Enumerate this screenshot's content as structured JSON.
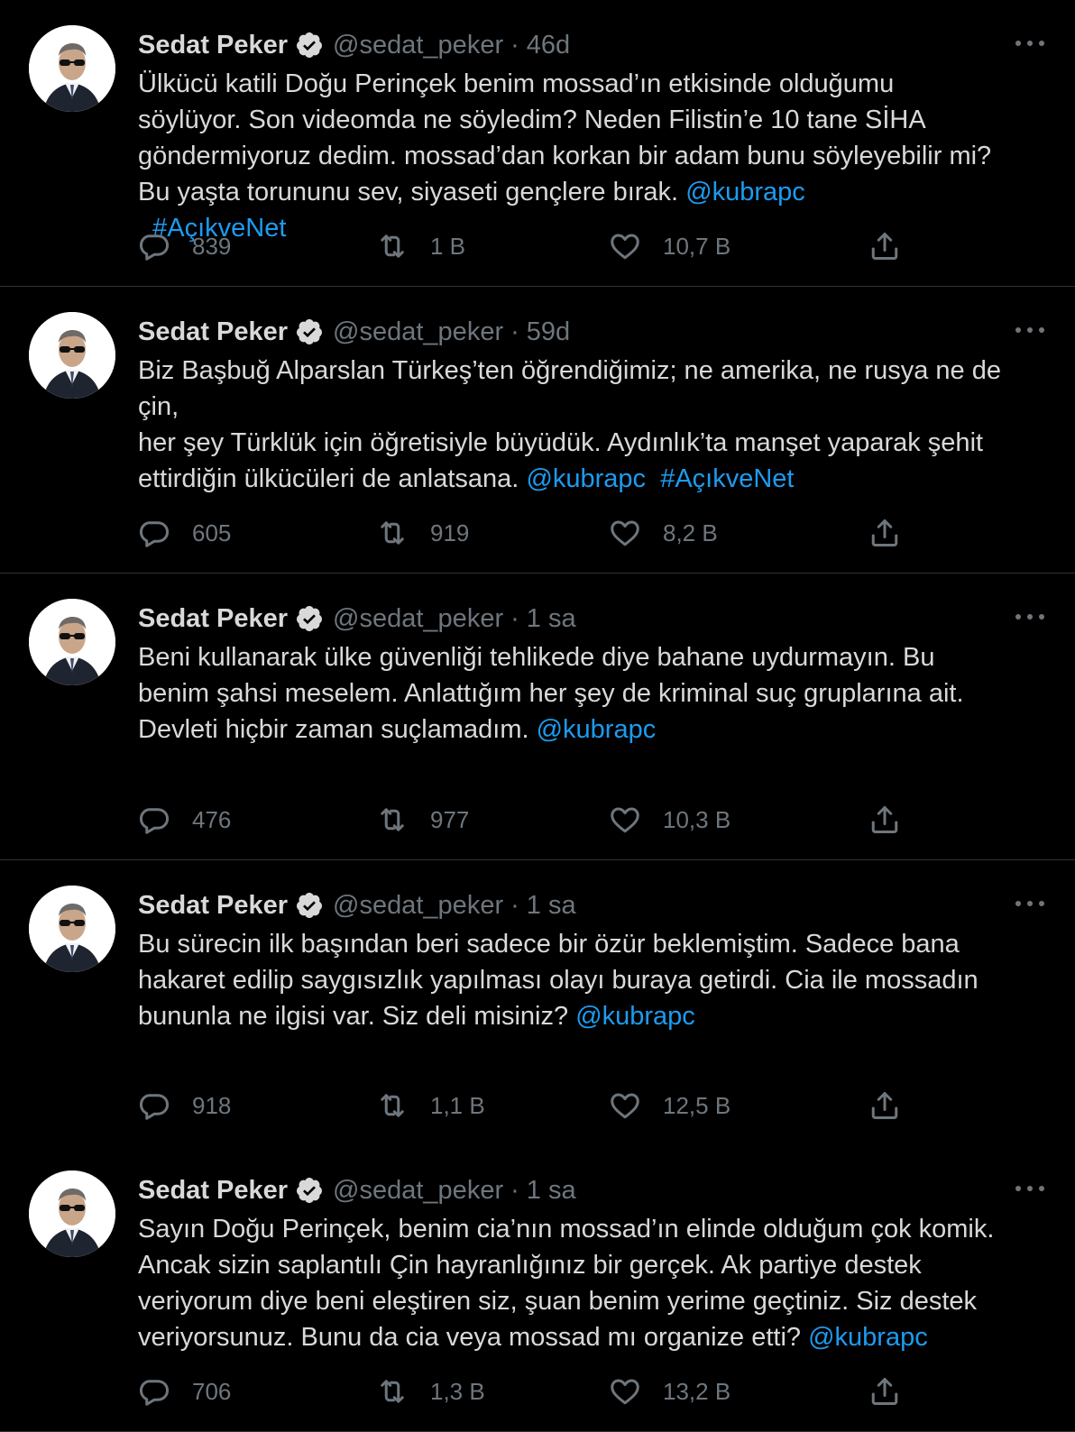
{
  "colors": {
    "background": "#000000",
    "text": "#d9d9d9",
    "muted": "#6e767d",
    "link": "#1d9bf0",
    "divider": "#2f3336"
  },
  "icons": {
    "reply": "speech-bubble-icon",
    "retweet": "retweet-arrows-icon",
    "like": "heart-icon",
    "share": "share-upload-icon",
    "verified": "verified-badge-icon",
    "more": "ellipsis-icon"
  },
  "tweets": [
    {
      "name": "Sedat Peker",
      "handle": "@sedat_peker",
      "sep": "·",
      "time": "46d",
      "lines": [
        [
          {
            "t": "Ülkücü katili Doğu Perinçek benim mossad’ın etkisinde olduğumu"
          }
        ],
        [
          {
            "t": "söylüyor. Son videomda ne söyledim? Neden Filistin’e 10 tane SİHA"
          }
        ],
        [
          {
            "t": "göndermiyoruz dedim. mossad’dan korkan bir adam bunu söyleyebilir mi?"
          }
        ],
        [
          {
            "t": "Bu yaşta torununu sev, siyaseti gençlere bırak. "
          },
          {
            "t": "@kubrapc",
            "link": true
          }
        ],
        [
          {
            "t": "  "
          },
          {
            "t": "#AçıkveNet",
            "link": true
          }
        ]
      ],
      "replies": "839",
      "retweets": "1 B",
      "likes": "10,7 B"
    },
    {
      "name": "Sedat Peker",
      "handle": "@sedat_peker",
      "sep": "·",
      "time": "59d",
      "lines": [
        [
          {
            "t": "Biz Başbuğ Alparslan Türkeş’ten öğrendiğimiz; ne amerika, ne rusya ne de"
          }
        ],
        [
          {
            "t": "çin,"
          }
        ],
        [
          {
            "t": "her şey Türklük için öğretisiyle büyüdük. Aydınlık’ta manşet yaparak şehit"
          }
        ],
        [
          {
            "t": "ettirdiğin ülkücüleri de anlatsana. "
          },
          {
            "t": "@kubrapc",
            "link": true
          },
          {
            "t": "  "
          },
          {
            "t": "#AçıkveNet",
            "link": true
          }
        ]
      ],
      "replies": "605",
      "retweets": "919",
      "likes": "8,2 B"
    },
    {
      "name": "Sedat Peker",
      "handle": "@sedat_peker",
      "sep": "·",
      "time": "1 sa",
      "lines": [
        [
          {
            "t": "Beni kullanarak ülke güvenliği tehlikede diye bahane uydurmayın. Bu"
          }
        ],
        [
          {
            "t": "benim şahsi meselem. Anlattığım her şey de kriminal suç gruplarına ait."
          }
        ],
        [
          {
            "t": "Devleti hiçbir zaman suçlamadım. "
          },
          {
            "t": "@kubrapc",
            "link": true
          }
        ]
      ],
      "replies": "476",
      "retweets": "977",
      "likes": "10,3 B"
    },
    {
      "name": "Sedat Peker",
      "handle": "@sedat_peker",
      "sep": "·",
      "time": "1 sa",
      "lines": [
        [
          {
            "t": "Bu sürecin ilk başından beri sadece bir özür beklemiştim. Sadece bana"
          }
        ],
        [
          {
            "t": "hakaret edilip saygısızlık yapılması olayı buraya getirdi. Cia ile mossadın"
          }
        ],
        [
          {
            "t": "bununla ne ilgisi var. Siz deli misiniz? "
          },
          {
            "t": "@kubrapc",
            "link": true
          }
        ]
      ],
      "replies": "918",
      "retweets": "1,1 B",
      "likes": "12,5 B"
    },
    {
      "name": "Sedat Peker",
      "handle": "@sedat_peker",
      "sep": "·",
      "time": "1 sa",
      "lines": [
        [
          {
            "t": "Sayın Doğu Perinçek, benim cia’nın mossad’ın elinde olduğum çok komik."
          }
        ],
        [
          {
            "t": "Ancak sizin saplantılı Çin hayranlığınız bir gerçek. Ak partiye destek"
          }
        ],
        [
          {
            "t": "veriyorum diye beni eleştiren siz, şuan benim yerime geçtiniz. Siz destek"
          }
        ],
        [
          {
            "t": "veriyorsunuz. Bunu da cia veya mossad mı organize etti? "
          },
          {
            "t": "@kubrapc",
            "link": true
          }
        ]
      ],
      "replies": "706",
      "retweets": "1,3 B",
      "likes": "13,2 B"
    }
  ]
}
